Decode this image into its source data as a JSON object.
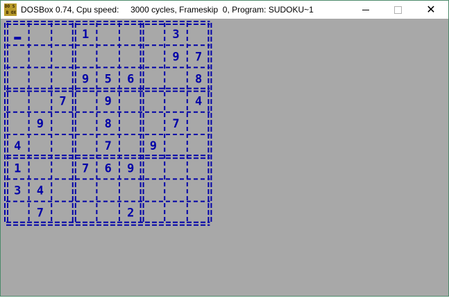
{
  "window": {
    "title": "DOSBox 0.74, Cpu speed:     3000 cycles, Frameskip  0, Program: SUDOKU~1",
    "icon": "dosbox-icon",
    "icon_text": [
      "DO",
      "S",
      "B",
      "OX"
    ]
  },
  "controls": {
    "minimize": "minimize-icon",
    "maximize": "maximize-icon",
    "close": "close-icon",
    "close_glyph": "✕"
  },
  "colors": {
    "grid": "#0000a8",
    "background": "#a8a8a8"
  },
  "sudoku": {
    "cursor": {
      "row": 0,
      "col": 0
    },
    "cells": [
      [
        "",
        "",
        "",
        "1",
        "",
        "",
        "",
        "3",
        ""
      ],
      [
        "",
        "",
        "",
        "",
        "",
        "",
        "",
        "9",
        "7"
      ],
      [
        "",
        "",
        "",
        "9",
        "5",
        "6",
        "",
        "",
        "8"
      ],
      [
        "",
        "",
        "7",
        "",
        "9",
        "",
        "",
        "",
        "4"
      ],
      [
        "",
        "9",
        "",
        "",
        "8",
        "",
        "",
        "7",
        ""
      ],
      [
        "4",
        "",
        "",
        "",
        "7",
        "",
        "9",
        "",
        ""
      ],
      [
        "1",
        "",
        "",
        "7",
        "6",
        "9",
        "",
        "",
        ""
      ],
      [
        "3",
        "4",
        "",
        "",
        "",
        "",
        "",
        "",
        ""
      ],
      [
        "",
        "7",
        "",
        "",
        "",
        "2",
        "",
        "",
        ""
      ]
    ]
  }
}
